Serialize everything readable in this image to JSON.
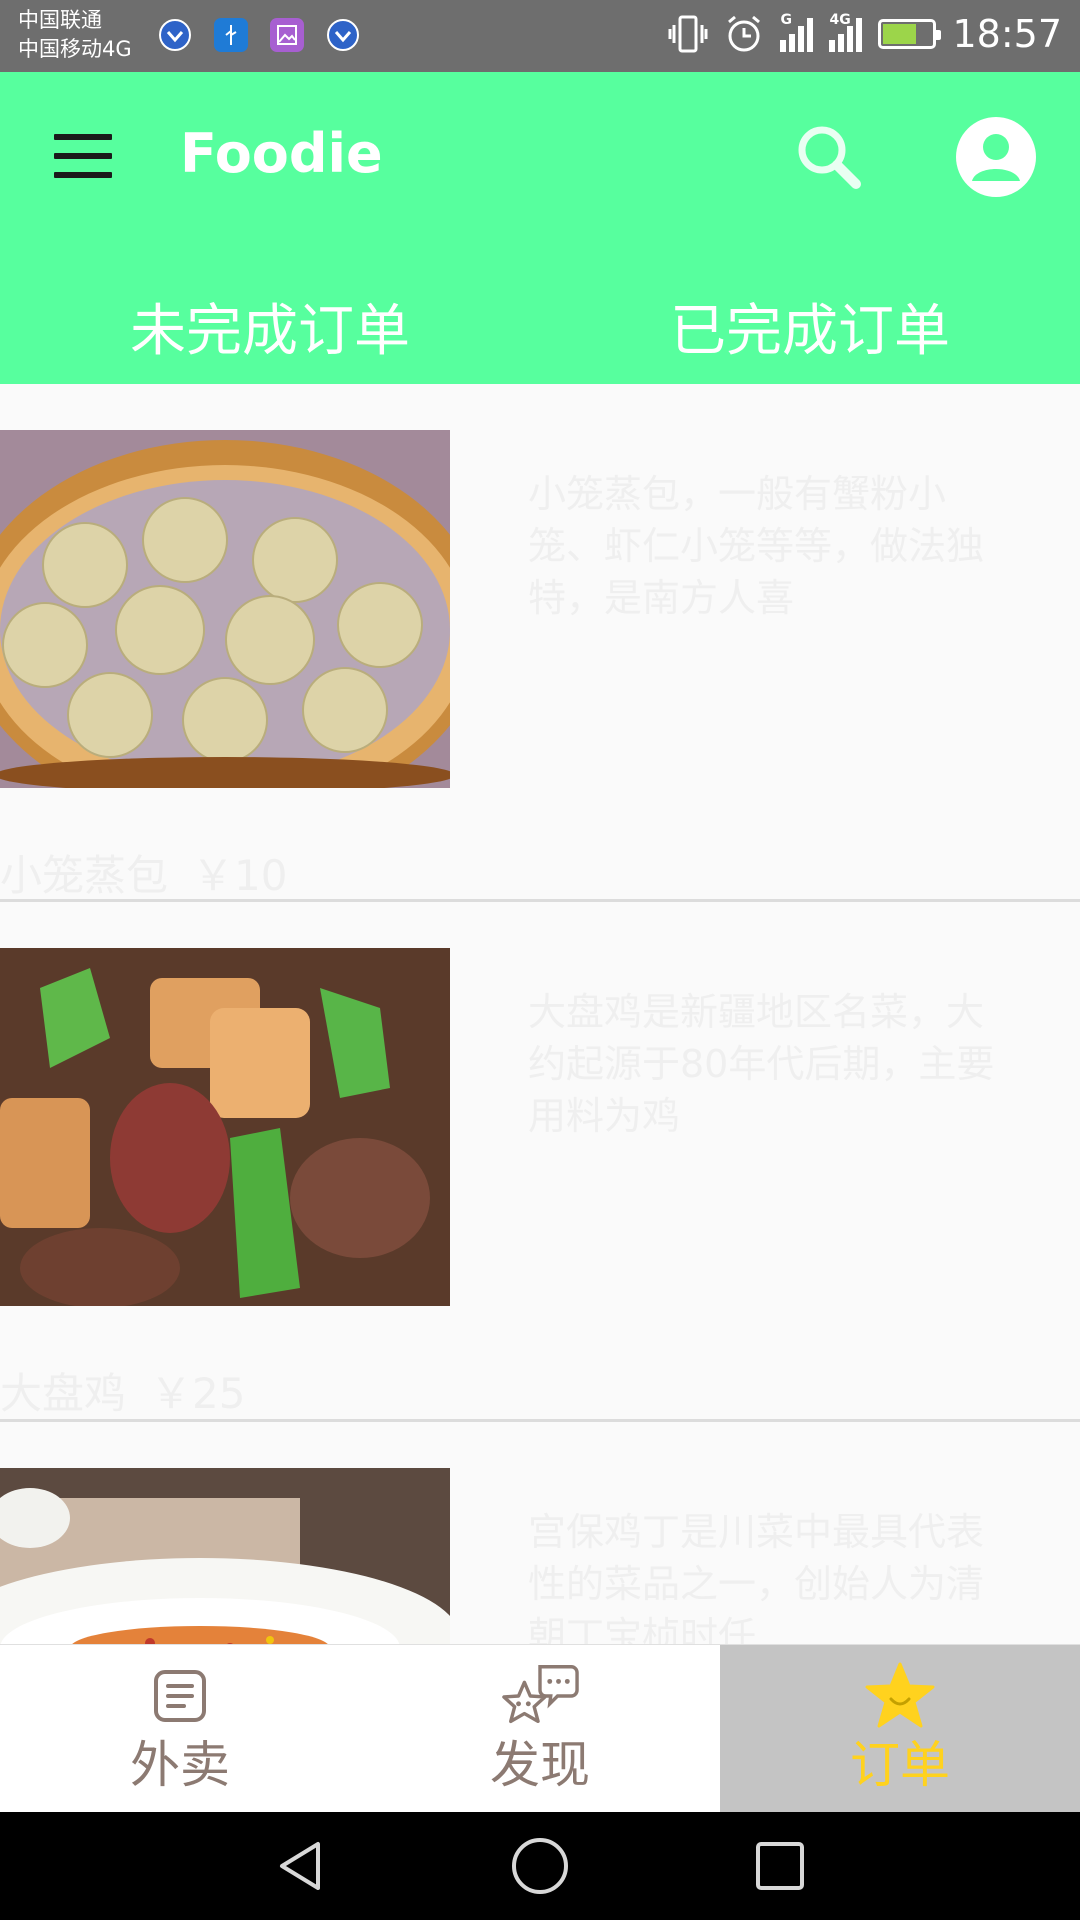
{
  "status_bar": {
    "carrier_1": "中国联通",
    "carrier_2": "中国移动4G",
    "net_1": "G",
    "net_2": "4G",
    "time": "18:57"
  },
  "app_bar": {
    "title": "Foodie",
    "accent_color": "#57ff9e",
    "menu_icon": "hamburger-menu-icon",
    "search_icon": "search-icon",
    "profile_icon": "account-circle-icon"
  },
  "tabs": [
    {
      "label": "未完成订单"
    },
    {
      "label": "已完成订单"
    }
  ],
  "orders": [
    {
      "image": "xiaolongbao-photo",
      "description": "小笼蒸包，一般有蟹粉小笼、虾仁小笼等等，做法独特，是南方人喜",
      "name": "小笼蒸包",
      "price": "￥10"
    },
    {
      "image": "dapanji-photo",
      "description": "大盘鸡是新疆地区名菜，大约起源于80年代后期，主要用料为鸡",
      "name": "大盘鸡",
      "price": "￥25"
    },
    {
      "image": "gongbao-chicken-photo",
      "description": "宫保鸡丁是川菜中最具代表性的菜品之一，创始人为清朝丁宝桢时任",
      "name": "",
      "price": ""
    }
  ],
  "bottom_nav": [
    {
      "label": "外卖",
      "icon": "list-icon",
      "active": false
    },
    {
      "label": "发现",
      "icon": "star-chat-icon",
      "active": false
    },
    {
      "label": "订单",
      "icon": "star-icon",
      "active": true
    }
  ],
  "system_nav": {
    "back_icon": "back-triangle-icon",
    "home_icon": "home-circle-icon",
    "recents_icon": "recents-square-icon"
  }
}
